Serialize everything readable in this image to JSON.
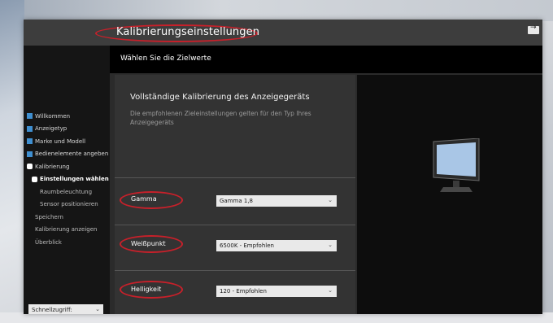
{
  "window": {
    "title": "Kalibrierungseinstellungen",
    "control_icon": "restore-icon"
  },
  "sidebar": {
    "items": [
      {
        "label": "Willkommen",
        "state": "done"
      },
      {
        "label": "Anzeigetyp",
        "state": "done"
      },
      {
        "label": "Marke und Modell",
        "state": "done"
      },
      {
        "label": "Bedienelemente angeben",
        "state": "done"
      },
      {
        "label": "Kalibrierung",
        "state": "active"
      },
      {
        "label": "Einstellungen wählen",
        "state": "active-sub"
      },
      {
        "label": "Raumbeleuchtung",
        "state": "sub"
      },
      {
        "label": "Sensor positionieren",
        "state": "sub"
      },
      {
        "label": "Speichern",
        "state": "pending"
      },
      {
        "label": "Kalibrierung anzeigen",
        "state": "pending"
      },
      {
        "label": "Überblick",
        "state": "pending"
      }
    ],
    "quick_access": {
      "label": "Schnellzugriff:",
      "chevron": "chevron-down-icon"
    }
  },
  "header": {
    "title": "Wählen Sie die Zielwerte"
  },
  "content": {
    "intro_title": "Vollständige Kalibrierung des Anzeigegeräts",
    "intro_desc": "Die empfohlenen Zieleinstellungen gelten für den Typ Ihres Anzeigegeräts",
    "settings": [
      {
        "label": "Gamma",
        "value": "Gamma 1,8"
      },
      {
        "label": "Weißpunkt",
        "value": "6500K - Empfohlen"
      },
      {
        "label": "Helligkeit",
        "value": "120 - Empfohlen"
      }
    ]
  },
  "colors": {
    "accent": "#3f8fd0",
    "annotation": "#c8202a",
    "monitor_screen": "#a9c6e6"
  }
}
